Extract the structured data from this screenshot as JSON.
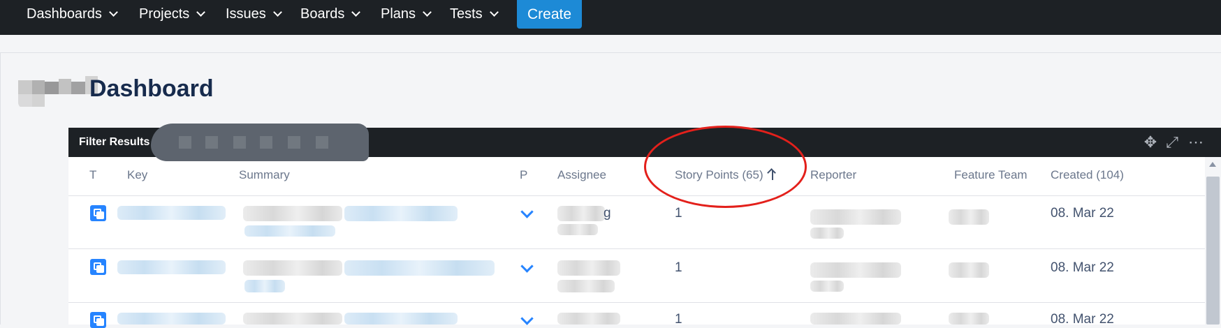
{
  "nav": {
    "items": [
      {
        "label": "Dashboards"
      },
      {
        "label": "Projects"
      },
      {
        "label": "Issues"
      },
      {
        "label": "Boards"
      },
      {
        "label": "Plans"
      },
      {
        "label": "Tests"
      }
    ],
    "create_label": "Create"
  },
  "page": {
    "title": "Dashboard"
  },
  "panel": {
    "title": "Filter Results",
    "icons": [
      "move-icon",
      "expand-icon",
      "more-icon"
    ]
  },
  "table": {
    "columns": [
      "T",
      "Key",
      "Summary",
      "P",
      "Assignee",
      "Story Points (65)",
      "Reporter",
      "Feature Team",
      "Created (104)"
    ],
    "sorted_column": "Story Points (65)",
    "rows": [
      {
        "assignee_fragment": "g",
        "story_points": "1",
        "created": "08. Mar 22"
      },
      {
        "story_points": "1",
        "created": "08. Mar 22"
      },
      {
        "story_points": "1",
        "created": "08. Mar 22"
      }
    ]
  },
  "colors": {
    "nav_bg": "#1d2125",
    "create_bg": "#1d8ad6",
    "annotation": "#e3201b",
    "issue_icon": "#2684ff"
  }
}
